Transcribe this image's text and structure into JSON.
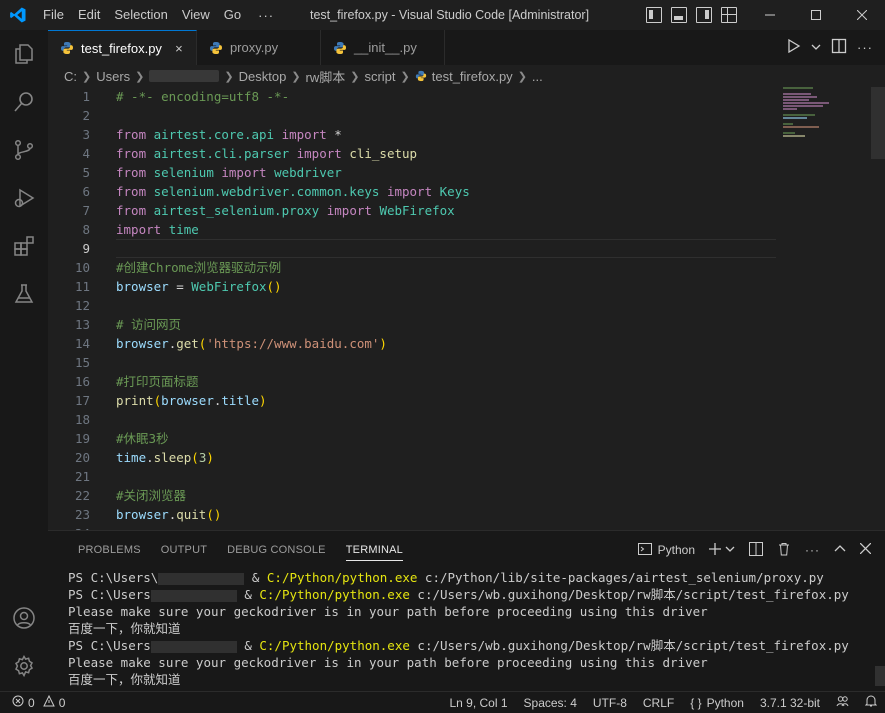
{
  "titlebar": {
    "menu": [
      "File",
      "Edit",
      "Selection",
      "View",
      "Go"
    ],
    "more": "···",
    "title": "test_firefox.py - Visual Studio Code [Administrator]"
  },
  "tabs": [
    {
      "label": "test_firefox.py",
      "active": true,
      "close": "×"
    },
    {
      "label": "proxy.py",
      "active": false
    },
    {
      "label": "__init__.py",
      "active": false
    }
  ],
  "breadcrumb": {
    "items": [
      "C:",
      "Users",
      "Desktop",
      "rw脚本",
      "script",
      "test_firefox.py",
      "..."
    ]
  },
  "editor": {
    "line_numbers": [
      "1",
      "2",
      "3",
      "4",
      "5",
      "6",
      "7",
      "8",
      "9",
      "10",
      "11",
      "12",
      "13",
      "14",
      "15",
      "16",
      "17",
      "18",
      "19",
      "20",
      "21",
      "22",
      "23",
      "24"
    ],
    "current_line": 9,
    "lines": [
      {
        "t": [
          [
            "cm",
            "# -*- encoding=utf8 -*-"
          ]
        ]
      },
      {
        "t": []
      },
      {
        "t": [
          [
            "kw",
            "from "
          ],
          [
            "mod",
            "airtest.core.api"
          ],
          [
            "kw",
            " import "
          ],
          [
            "plain",
            "*"
          ]
        ]
      },
      {
        "t": [
          [
            "kw",
            "from "
          ],
          [
            "mod",
            "airtest.cli.parser"
          ],
          [
            "kw",
            " import "
          ],
          [
            "fn",
            "cli_setup"
          ]
        ]
      },
      {
        "t": [
          [
            "kw",
            "from "
          ],
          [
            "mod",
            "selenium"
          ],
          [
            "kw",
            " import "
          ],
          [
            "mod",
            "webdriver"
          ]
        ]
      },
      {
        "t": [
          [
            "kw",
            "from "
          ],
          [
            "mod",
            "selenium.webdriver.common.keys"
          ],
          [
            "kw",
            " import "
          ],
          [
            "mod",
            "Keys"
          ]
        ]
      },
      {
        "t": [
          [
            "kw",
            "from "
          ],
          [
            "mod",
            "airtest_selenium.proxy"
          ],
          [
            "kw",
            " import "
          ],
          [
            "mod",
            "WebFirefox"
          ]
        ]
      },
      {
        "t": [
          [
            "kw",
            "import "
          ],
          [
            "mod",
            "time"
          ]
        ]
      },
      {
        "t": []
      },
      {
        "t": [
          [
            "cm",
            "#创建Chrome浏览器驱动示例"
          ]
        ]
      },
      {
        "t": [
          [
            "var",
            "browser"
          ],
          [
            "plain",
            " = "
          ],
          [
            "mod",
            "WebFirefox"
          ],
          [
            "br1",
            "()"
          ]
        ]
      },
      {
        "t": []
      },
      {
        "t": [
          [
            "cm",
            "# 访问网页"
          ]
        ]
      },
      {
        "t": [
          [
            "var",
            "browser"
          ],
          [
            "plain",
            "."
          ],
          [
            "fn",
            "get"
          ],
          [
            "br1",
            "("
          ],
          [
            "str",
            "'https://www.baidu.com'"
          ],
          [
            "br1",
            ")"
          ]
        ]
      },
      {
        "t": []
      },
      {
        "t": [
          [
            "cm",
            "#打印页面标题"
          ]
        ]
      },
      {
        "t": [
          [
            "fn",
            "print"
          ],
          [
            "br1",
            "("
          ],
          [
            "var",
            "browser"
          ],
          [
            "plain",
            "."
          ],
          [
            "var",
            "title"
          ],
          [
            "br1",
            ")"
          ]
        ]
      },
      {
        "t": []
      },
      {
        "t": [
          [
            "cm",
            "#休眠3秒"
          ]
        ]
      },
      {
        "t": [
          [
            "var",
            "time"
          ],
          [
            "plain",
            "."
          ],
          [
            "fn",
            "sleep"
          ],
          [
            "br1",
            "("
          ],
          [
            "num",
            "3"
          ],
          [
            "br1",
            ")"
          ]
        ]
      },
      {
        "t": []
      },
      {
        "t": [
          [
            "cm",
            "#关闭浏览器"
          ]
        ]
      },
      {
        "t": [
          [
            "var",
            "browser"
          ],
          [
            "plain",
            "."
          ],
          [
            "fn",
            "quit"
          ],
          [
            "br1",
            "()"
          ]
        ]
      },
      {
        "t": []
      }
    ]
  },
  "panel": {
    "tabs": [
      "PROBLEMS",
      "OUTPUT",
      "DEBUG CONSOLE",
      "TERMINAL"
    ],
    "active_tab": "TERMINAL",
    "shell_label": "Python",
    "terminal": [
      {
        "prefix": "PS C:\\Users\\",
        "masked": true,
        "amp": " & ",
        "exe": "C:/Python/python.exe",
        "rest": " c:/Python/lib/site-packages/airtest_selenium/proxy.py"
      },
      {
        "prefix": "PS C:\\Users",
        "masked": true,
        "amp": " & ",
        "exe": "C:/Python/python.exe",
        "rest": " c:/Users/wb.guxihong/Desktop/rw脚本/script/test_firefox.py"
      },
      {
        "text": "Please make sure your geckodriver is in your path before proceeding using this driver"
      },
      {
        "text": "百度一下，你就知道"
      },
      {
        "prefix": "PS C:\\Users",
        "masked": true,
        "amp": " & ",
        "exe": "C:/Python/python.exe",
        "rest": " c:/Users/wb.guxihong/Desktop/rw脚本/script/test_firefox.py"
      },
      {
        "text": "Please make sure your geckodriver is in your path before proceeding using this driver"
      },
      {
        "text": "百度一下，你就知道"
      }
    ]
  },
  "statusbar": {
    "errors": "0",
    "warnings": "0",
    "position": "Ln 9, Col 1",
    "spaces": "Spaces: 4",
    "encoding": "UTF-8",
    "eol": "CRLF",
    "language": "Python",
    "interpreter": "3.7.1 32-bit"
  }
}
